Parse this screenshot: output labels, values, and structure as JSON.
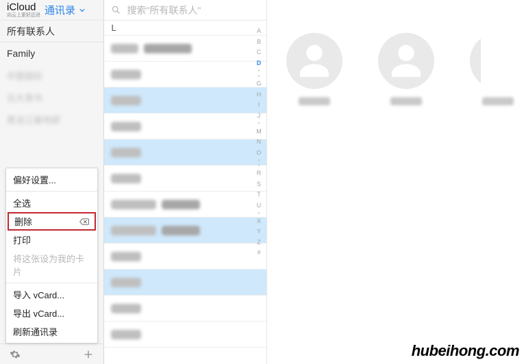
{
  "header": {
    "brand": "iCloud",
    "brand_sub": "向云上更好迈进",
    "app_title": "通讯录"
  },
  "sidebar": {
    "all_contacts": "所有联系人",
    "family": "Family"
  },
  "context_menu": {
    "preferences": "偏好设置...",
    "select_all": "全选",
    "delete": "删除",
    "print": "打印",
    "set_my_card": "将这张设为我的卡片",
    "import_vcard": "导入 vCard...",
    "export_vcard": "导出 vCard...",
    "refresh": "刷新通讯录"
  },
  "search": {
    "placeholder": "搜索\"所有联系人\""
  },
  "contacts": {
    "section": "L",
    "rows": [
      {
        "selected": false,
        "w1": 40,
        "w2": 70
      },
      {
        "selected": false,
        "w1": 44
      },
      {
        "selected": true,
        "w1": 44
      },
      {
        "selected": false,
        "w1": 44
      },
      {
        "selected": true,
        "w1": 44
      },
      {
        "selected": false,
        "w1": 44
      },
      {
        "selected": false,
        "w1": 66,
        "w2": 56
      },
      {
        "selected": true,
        "w1": 66,
        "w2": 56
      },
      {
        "selected": false,
        "w1": 44
      },
      {
        "selected": true,
        "w1": 44
      },
      {
        "selected": false,
        "w1": 44
      },
      {
        "selected": false,
        "w1": 44
      }
    ]
  },
  "index_letters": [
    "A",
    "B",
    "C",
    "D",
    "",
    "",
    "G",
    "H",
    "I",
    "J",
    "",
    "M",
    "N",
    "O",
    "",
    "",
    "R",
    "S",
    "T",
    "U",
    "",
    "X",
    "Y",
    "Z",
    "#"
  ],
  "index_current": "D",
  "watermark": "hubeihong.com"
}
